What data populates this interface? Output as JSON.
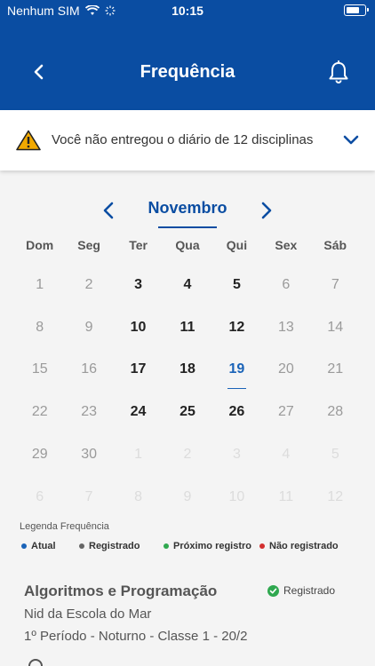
{
  "status_bar": {
    "carrier": "Nenhum SIM",
    "time": "10:15"
  },
  "nav": {
    "title": "Frequência"
  },
  "alert": {
    "text": "Você não entregou o diário de 12 disciplinas"
  },
  "calendar": {
    "month": "Novembro",
    "weekdays": [
      "Dom",
      "Seg",
      "Ter",
      "Qua",
      "Qui",
      "Sex",
      "Sáb"
    ],
    "days": [
      {
        "label": "1",
        "state": "inactive"
      },
      {
        "label": "2",
        "state": "inactive"
      },
      {
        "label": "3",
        "state": "active"
      },
      {
        "label": "4",
        "state": "active"
      },
      {
        "label": "5",
        "state": "active"
      },
      {
        "label": "6",
        "state": "inactive"
      },
      {
        "label": "7",
        "state": "inactive"
      },
      {
        "label": "8",
        "state": "inactive"
      },
      {
        "label": "9",
        "state": "inactive"
      },
      {
        "label": "10",
        "state": "active"
      },
      {
        "label": "11",
        "state": "active"
      },
      {
        "label": "12",
        "state": "active"
      },
      {
        "label": "13",
        "state": "inactive"
      },
      {
        "label": "14",
        "state": "inactive"
      },
      {
        "label": "15",
        "state": "inactive"
      },
      {
        "label": "16",
        "state": "inactive"
      },
      {
        "label": "17",
        "state": "active"
      },
      {
        "label": "18",
        "state": "active"
      },
      {
        "label": "19",
        "state": "today"
      },
      {
        "label": "20",
        "state": "inactive"
      },
      {
        "label": "21",
        "state": "inactive"
      },
      {
        "label": "22",
        "state": "inactive"
      },
      {
        "label": "23",
        "state": "inactive"
      },
      {
        "label": "24",
        "state": "active"
      },
      {
        "label": "25",
        "state": "active"
      },
      {
        "label": "26",
        "state": "active"
      },
      {
        "label": "27",
        "state": "inactive"
      },
      {
        "label": "28",
        "state": "inactive"
      },
      {
        "label": "29",
        "state": "inactive"
      },
      {
        "label": "30",
        "state": "inactive"
      },
      {
        "label": "1",
        "state": "other"
      },
      {
        "label": "2",
        "state": "other"
      },
      {
        "label": "3",
        "state": "other"
      },
      {
        "label": "4",
        "state": "other"
      },
      {
        "label": "5",
        "state": "other"
      },
      {
        "label": "6",
        "state": "other"
      },
      {
        "label": "7",
        "state": "other"
      },
      {
        "label": "8",
        "state": "other"
      },
      {
        "label": "9",
        "state": "other"
      },
      {
        "label": "10",
        "state": "other"
      },
      {
        "label": "11",
        "state": "other"
      },
      {
        "label": "12",
        "state": "other"
      }
    ]
  },
  "legend": {
    "title": "Legenda Frequência",
    "items": [
      {
        "label": "Atual",
        "color": "#1a63b8"
      },
      {
        "label": "Registrado",
        "color": "#666666"
      },
      {
        "label": "Próximo registro",
        "color": "#2fa84f"
      },
      {
        "label": "Não registrado",
        "color": "#d32f2f"
      }
    ]
  },
  "course": {
    "title": "Algoritmos e Programação",
    "status": "Registrado",
    "school": "Nid da Escola do Mar",
    "period": "1º Período  - Noturno - Classe 1 - 20/2"
  },
  "colors": {
    "primary": "#0a4da2",
    "today": "#1a63b8",
    "alert_icon": "#f2a900"
  },
  "icons": [
    "back-chevron-icon",
    "bell-icon",
    "warning-icon",
    "chevron-down-icon",
    "chevron-left-icon",
    "chevron-right-icon",
    "check-circle-icon",
    "wifi-icon",
    "battery-icon"
  ]
}
